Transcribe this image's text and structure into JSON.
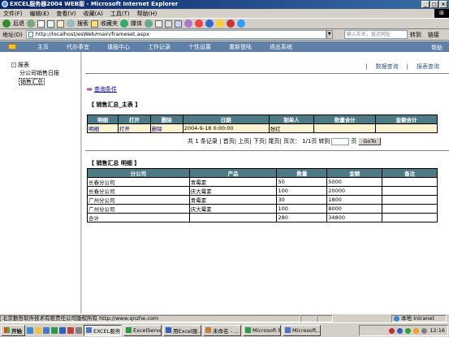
{
  "window": {
    "title": "EXCEL服务器2004 WEB版 - Microsoft Internet Explorer",
    "win_flag": "⊞"
  },
  "menubar": {
    "items": [
      "文件(F)",
      "编辑(E)",
      "查看(V)",
      "收藏(A)",
      "工具(T)",
      "帮助(H)"
    ]
  },
  "toolbar": {
    "back": "后退",
    "search": "搜索",
    "favorites": "收藏夹",
    "media": "媒体"
  },
  "address": {
    "label": "地址(D)",
    "url": "http://localhost/esWeb/main/frameset.aspx",
    "search_placeholder": "输入实名，直达网址",
    "go": "转到",
    "links": "链接"
  },
  "nav": {
    "items": [
      "主页",
      "代办事宜",
      "填报中心",
      "工作记录",
      "个性设置",
      "重新登陆",
      "退出系统"
    ],
    "help": "帮助"
  },
  "sidebar": {
    "root": "报表",
    "toggle": "-",
    "children": [
      "分公司销售日报",
      "销售汇总"
    ]
  },
  "tabs": {
    "data_query": "数据查询",
    "report_query": "报表查询",
    "separator": "|"
  },
  "query_link": "查询条件",
  "summary": {
    "title": "【  销售汇总_主表  】",
    "headers": [
      "明细",
      "打开",
      "删除",
      "日期",
      "制单人",
      "数量合计",
      "金额合计"
    ],
    "row": [
      "明细",
      "打开",
      "删除",
      "2004-9-18 0:00:00",
      "张红",
      "",
      ""
    ]
  },
  "pager": {
    "text1": "共 1 条记录 | 首页| 上页| 下页| 尾页| 页次：",
    "page_info": "1/1页",
    "text2": "转到",
    "text3": "页",
    "go": "GoTo"
  },
  "detail": {
    "title": "【  销售汇总 明细  】",
    "headers": [
      "分公司",
      "产品",
      "数量",
      "金额",
      "备注"
    ],
    "rows": [
      [
        "长春分公司",
        "青霉素",
        "50",
        "5000",
        ""
      ],
      [
        "长春分公司",
        "庆大霉素",
        "100",
        "20000",
        ""
      ],
      [
        "广州分公司",
        "青霉素",
        "30",
        "1800",
        ""
      ],
      [
        "广州分公司",
        "庆大霉素",
        "100",
        "8000",
        ""
      ],
      [
        "合计",
        "",
        "280",
        "34800",
        ""
      ]
    ]
  },
  "status": {
    "company": "北京勤哲软件技术有限责任公司版权所有 http://www.qnzhe.com",
    "zone": "本地 Intranet"
  },
  "taskbar": {
    "start": "开始",
    "tasks": [
      "EXCEL服务...",
      "ExcelServer...",
      "用Excel服...",
      "未命名 - ...",
      "Microsoft E...",
      "Microsoft..."
    ],
    "clock": "12:16"
  }
}
